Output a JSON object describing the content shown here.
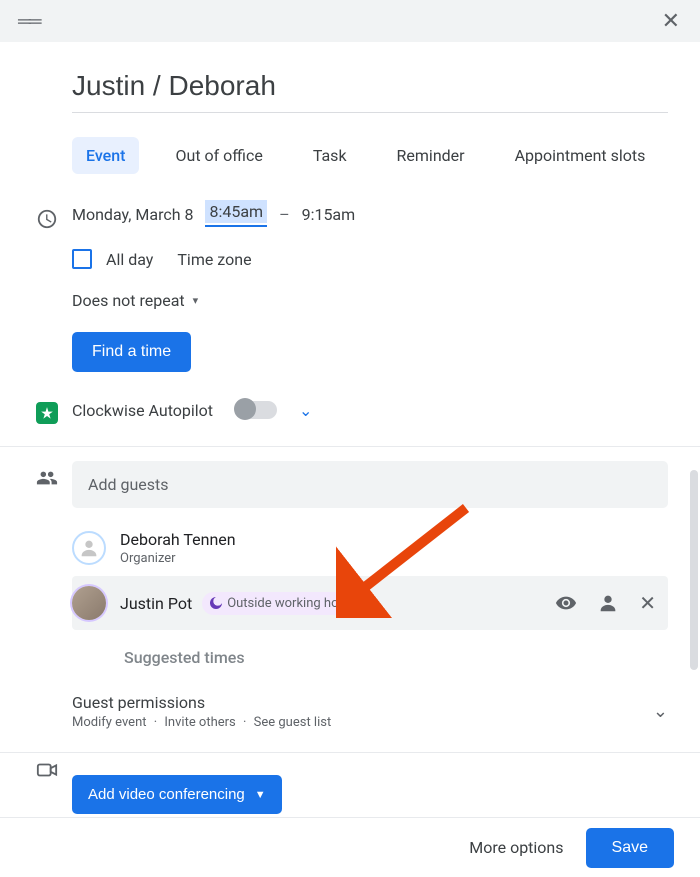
{
  "header": {
    "has_close": true
  },
  "event": {
    "title": "Justin / Deborah",
    "tabs": [
      {
        "label": "Event",
        "active": true
      },
      {
        "label": "Out of office"
      },
      {
        "label": "Task"
      },
      {
        "label": "Reminder"
      },
      {
        "label": "Appointment slots"
      }
    ],
    "date": "Monday, March 8",
    "time_start": "8:45am",
    "dash": "–",
    "time_end": "9:15am",
    "all_day_label": "All day",
    "all_day_checked": false,
    "time_zone_label": "Time zone",
    "repeat": "Does not repeat",
    "find_time_label": "Find a time"
  },
  "clockwise": {
    "label": "Clockwise Autopilot",
    "enabled": false
  },
  "guests": {
    "placeholder": "Add guests",
    "list": [
      {
        "name": "Deborah Tennen",
        "role": "Organizer",
        "avatar": "outline"
      },
      {
        "name": "Justin Pot",
        "badge": "Outside working hours",
        "avatar": "photo",
        "hovered": true
      }
    ],
    "suggested_times_label": "Suggested times",
    "permissions": {
      "title": "Guest permissions",
      "sub_parts": [
        "Modify event",
        "·",
        "Invite others",
        "·",
        "See guest list"
      ]
    }
  },
  "video": {
    "button_label": "Add video conferencing"
  },
  "footer": {
    "more_options": "More options",
    "save": "Save"
  }
}
